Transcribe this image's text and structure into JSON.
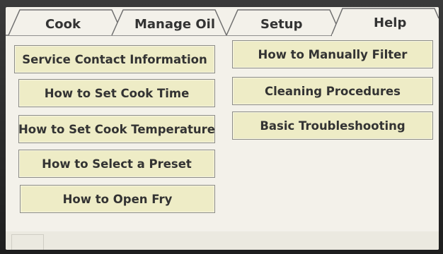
{
  "tabs": [
    {
      "id": "cook",
      "label": "Cook"
    },
    {
      "id": "manage-oil",
      "label": "Manage Oil"
    },
    {
      "id": "setup",
      "label": "Setup"
    },
    {
      "id": "help",
      "label": "Help"
    }
  ],
  "active_tab": "Help",
  "help": {
    "left_column": [
      {
        "label": "Service Contact Information"
      },
      {
        "label": "How to Set Cook Time"
      },
      {
        "label": "How to Set Cook Temperature"
      },
      {
        "label": "How to Select a Preset"
      },
      {
        "label": "How to Open Fry"
      }
    ],
    "right_column": [
      {
        "label": "How to Manually Filter"
      },
      {
        "label": "Cleaning Procedures"
      },
      {
        "label": "Basic Troubleshooting"
      }
    ]
  },
  "colors": {
    "screen_background": "#f3f1ea",
    "button_fill": "#eeecc6",
    "button_border": "#8c8c86",
    "text": "#333333"
  }
}
